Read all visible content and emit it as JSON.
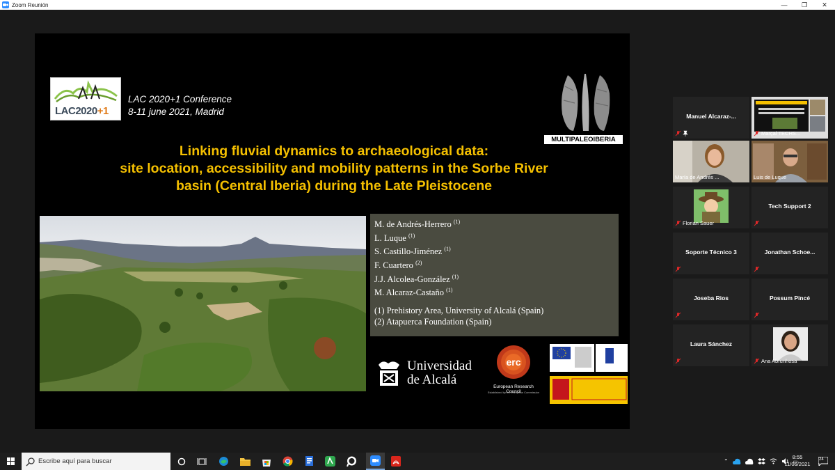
{
  "window": {
    "title": "Zoom Reunión",
    "minimize": "—",
    "restore": "❐",
    "close": "✕"
  },
  "slide": {
    "logo_text_main": "LAC2020",
    "logo_text_plus": "+1",
    "conference_line1": "LAC 2020+1 Conference",
    "conference_line2": "8-11 june 2021, Madrid",
    "project_badge": "MULTIPALEOIBERIA",
    "title_line1": "Linking fluvial dynamics to archaeological data:",
    "title_line2": "site location, accessibility and mobility patterns in the Sorbe River",
    "title_line3": "basin (Central Iberia) during the Late Pleistocene",
    "authors": [
      {
        "name": "M. de Andrés-Herrero",
        "aff": "(1)"
      },
      {
        "name": "L. Luque",
        "aff": "(1)"
      },
      {
        "name": "S. Castillo-Jiménez",
        "aff": "(1)"
      },
      {
        "name": "F. Cuartero",
        "aff": "(2)"
      },
      {
        "name": "J.J. Alcolea-González",
        "aff": "(1)"
      },
      {
        "name": "M. Alcaraz-Castaño",
        "aff": "(1)"
      }
    ],
    "affiliations": [
      "(1) Prehistory Area, University of Alcalá (Spain)",
      "(2) Atapuerca Foundation (Spain)"
    ],
    "uah_line1": "Universidad",
    "uah_line2": "de Alcalá",
    "erc_logo": "erc",
    "erc_name": "European Research Council",
    "erc_established": "Established by the European Commission"
  },
  "participants": [
    {
      "name": "Manuel  Alcaraz-...",
      "label": "",
      "mic": "muted",
      "pinned": true
    },
    {
      "name": "",
      "label": "Marçal TECHS...",
      "mic": "muted"
    },
    {
      "name": "",
      "label": "María de Andrés ...",
      "mic": "none"
    },
    {
      "name": "",
      "label": "Luis de Luque",
      "mic": "none",
      "active": true
    },
    {
      "name": "",
      "label": "Florian Sauer",
      "mic": "muted"
    },
    {
      "name": "Tech Support 2",
      "label": "",
      "mic": "muted"
    },
    {
      "name": "Soporte Técnico 3",
      "label": "",
      "mic": "muted"
    },
    {
      "name": "Jonathan  Schoe...",
      "label": "",
      "mic": "muted"
    },
    {
      "name": "Joseba Rios",
      "label": "",
      "mic": "muted"
    },
    {
      "name": "Possum Pincé",
      "label": "",
      "mic": "muted"
    },
    {
      "name": "Laura Sánchez",
      "label": "",
      "mic": "muted"
    },
    {
      "name": "",
      "label": "Ana Abrunhosa",
      "mic": "muted"
    }
  ],
  "taskbar": {
    "search_placeholder": "Escribe aquí para buscar",
    "time": "8:55",
    "date": "11/06/2021",
    "notifications": "24"
  },
  "colors": {
    "title_yellow": "#f5c000",
    "authors_bg": "#4a4b40",
    "active_border": "#e3e35a",
    "muted_red": "#e02828",
    "zoom_blue": "#2d8cff"
  }
}
